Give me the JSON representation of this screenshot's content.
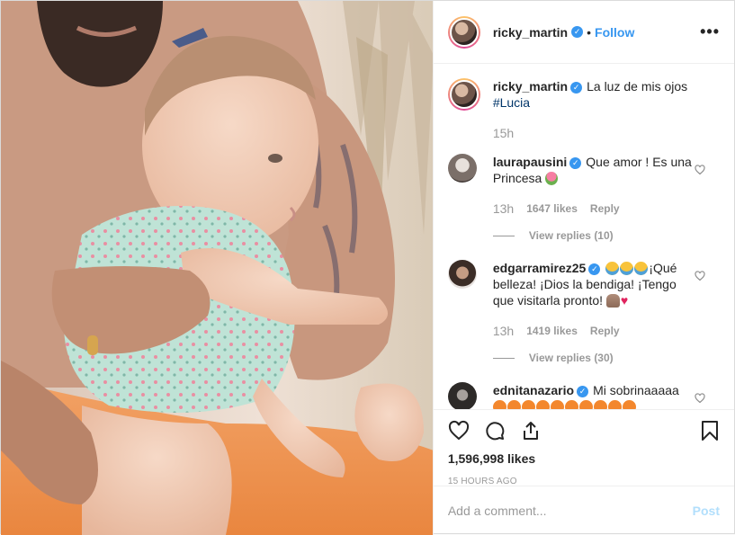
{
  "header": {
    "username": "ricky_martin",
    "separator": "•",
    "follow_label": "Follow",
    "more_label": "•••"
  },
  "caption": {
    "username": "ricky_martin",
    "text": "La luz de mis ojos",
    "hashtag": "#Lucia",
    "time": "15h"
  },
  "comments": [
    {
      "username": "laurapausini",
      "text": "Que amor ! Es una Princesa",
      "emoji": [
        "tulip"
      ],
      "time": "13h",
      "likes": "1647 likes",
      "reply_label": "Reply",
      "view_replies": "View replies (10)"
    },
    {
      "username": "edgarramirez25",
      "text_before": "",
      "text_after": "¡Qué belleza! ¡Dios la bendiga! ¡Tengo que visitarla pronto!",
      "emoji_before": [
        "crying-face",
        "crying-face",
        "crying-face"
      ],
      "emoji_after": [
        "folded-hands",
        "red-heart"
      ],
      "time": "13h",
      "likes": "1419 likes",
      "reply_label": "Reply",
      "view_replies": "View replies (30)"
    },
    {
      "username": "ednitanazario",
      "text": "Mi sobrinaaaaa",
      "emoji": [
        "heart-eyes",
        "heart-eyes",
        "heart-eyes",
        "heart-eyes",
        "heart-eyes",
        "heart-eyes",
        "heart-eyes",
        "heart-eyes",
        "heart-eyes",
        "heart-eyes"
      ]
    }
  ],
  "actions": {
    "likes_count": "1,596,998 likes",
    "post_time": "15 HOURS AGO"
  },
  "add_comment": {
    "placeholder": "Add a comment...",
    "post_label": "Post"
  },
  "colors": {
    "link_blue": "#3897f0",
    "hashtag": "#003569",
    "muted": "#999999",
    "post_disabled": "#b2dffc"
  }
}
